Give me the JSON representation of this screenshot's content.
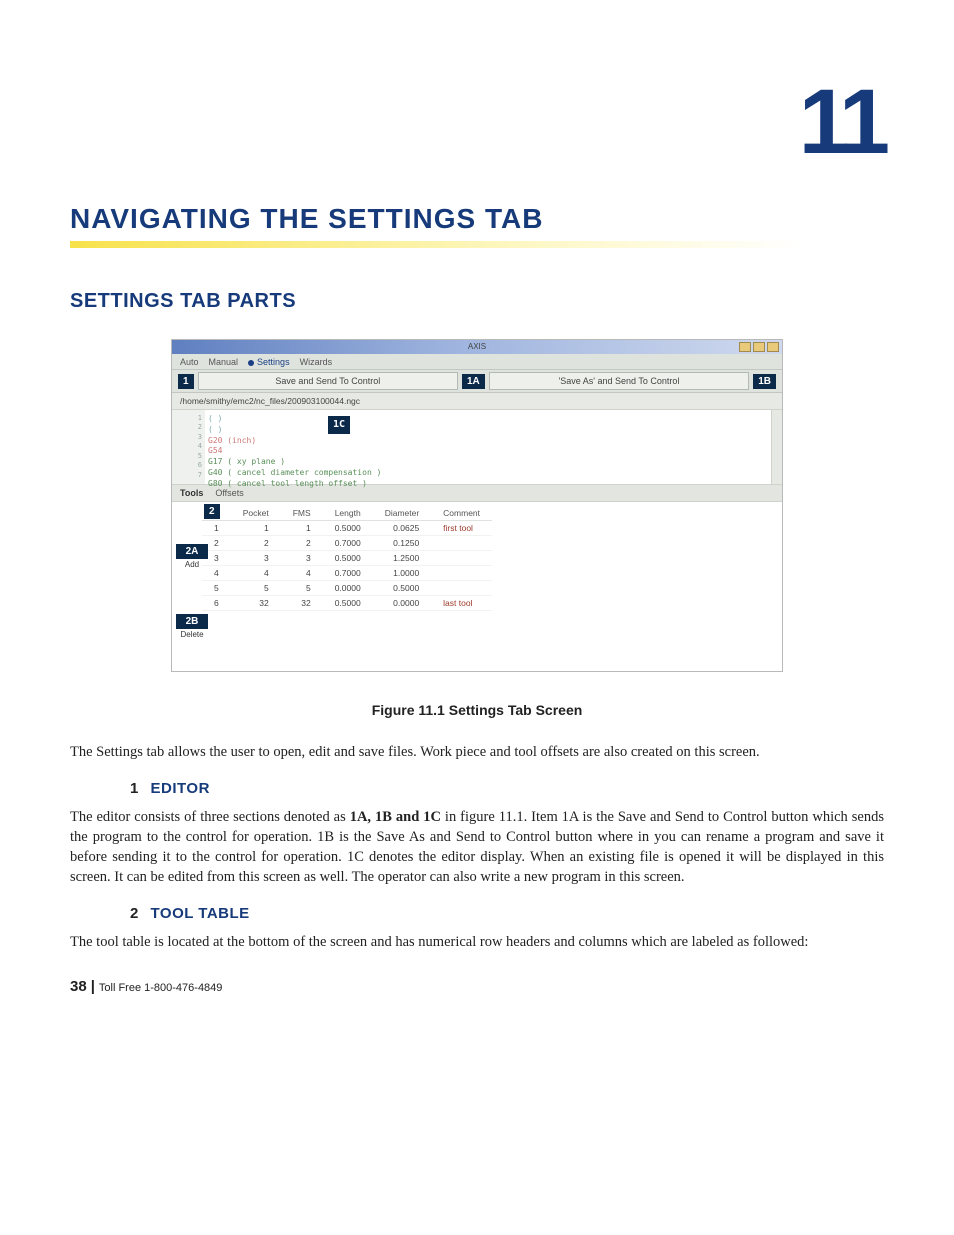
{
  "chapter_number": "11",
  "chapter_title": "NAVIGATING THE SETTINGS TAB",
  "section_title": "SETTINGS TAB PARTS",
  "figure_caption": "Figure 11.1 Settings Tab Screen",
  "intro_para": "The Settings tab allows the user to open, edit and save files.  Work piece and tool offsets are also created on this screen.",
  "sub1": {
    "num": "1",
    "title": "EDITOR"
  },
  "editor_para_a": "The editor consists of three sections denoted as ",
  "editor_para_bold": "1A, 1B and 1C",
  "editor_para_b": " in figure 11.1. Item 1A is the Save and Send to Control button which sends the program to the control for operation. 1B is the Save As and Send to Control button where in you can rename a program and save it before sending it to the control for operation. 1C denotes the editor display.  When an existing file is opened it will be displayed in this screen. It can be edited from this screen as well.  The operator can also write a new program in this screen.",
  "sub2": {
    "num": "2",
    "title": "TOOL TABLE"
  },
  "tool_para": "The tool table is located at the bottom of the screen and has numerical row headers and columns which are labeled as followed:",
  "footer": {
    "page": "38",
    "text": "Toll Free 1-800-476-4849"
  },
  "shot": {
    "titlebar": "AXIS",
    "tabs": [
      "Auto",
      "Manual",
      "Settings",
      "Wizards"
    ],
    "btn_save": "Save and Send To Control",
    "btn_saveas": "'Save As' and Send To Control",
    "path": "/home/smithy/emc2/nc_files/200903100044.ngc",
    "code": [
      "( )",
      "( )",
      "G20 (inch)",
      "G54",
      "G17 ( xy plane )",
      "G40 ( cancel diameter compensation )",
      "G80 ( cancel tool length offset )"
    ],
    "subtabs": [
      "Tools",
      "Offsets"
    ],
    "headers": [
      "",
      "Pocket",
      "FMS",
      "Length",
      "Diameter",
      "Comment"
    ],
    "rows": [
      {
        "n": "1",
        "idx": "1",
        "pocket": "1",
        "fms": "",
        "length": "0.5000",
        "diameter": "0.0625",
        "comment": "first tool"
      },
      {
        "n": "2",
        "idx": "2",
        "pocket": "2",
        "fms": "",
        "length": "0.7000",
        "diameter": "0.1250",
        "comment": ""
      },
      {
        "n": "3",
        "idx": "3",
        "pocket": "3",
        "fms": "",
        "length": "0.5000",
        "diameter": "1.2500",
        "comment": ""
      },
      {
        "n": "4",
        "idx": "4",
        "pocket": "4",
        "fms": "",
        "length": "0.7000",
        "diameter": "1.0000",
        "comment": ""
      },
      {
        "n": "5",
        "idx": "5",
        "pocket": "5",
        "fms": "",
        "length": "0.0000",
        "diameter": "0.5000",
        "comment": ""
      },
      {
        "n": "6",
        "idx": "32",
        "pocket": "32",
        "fms": "",
        "length": "0.5000",
        "diameter": "0.0000",
        "comment": "last tool"
      }
    ],
    "callouts": {
      "one": "1",
      "oneA": "1A",
      "oneB": "1B",
      "oneC": "1C",
      "two": "2",
      "twoA": "2A",
      "twoB": "2B",
      "add": "Add",
      "del": "Delete"
    }
  }
}
